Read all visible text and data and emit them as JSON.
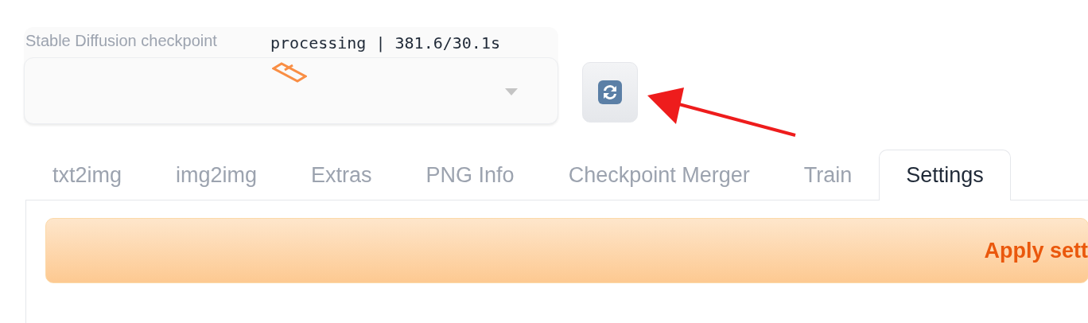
{
  "checkpoint": {
    "label": "Stable Diffusion checkpoint",
    "status": "processing | 381.6/30.1s"
  },
  "tabs": [
    {
      "label": "txt2img",
      "selected": false
    },
    {
      "label": "img2img",
      "selected": false
    },
    {
      "label": "Extras",
      "selected": false
    },
    {
      "label": "PNG Info",
      "selected": false
    },
    {
      "label": "Checkpoint Merger",
      "selected": false
    },
    {
      "label": "Train",
      "selected": false
    },
    {
      "label": "Settings",
      "selected": true
    }
  ],
  "apply_button": "Apply sett"
}
